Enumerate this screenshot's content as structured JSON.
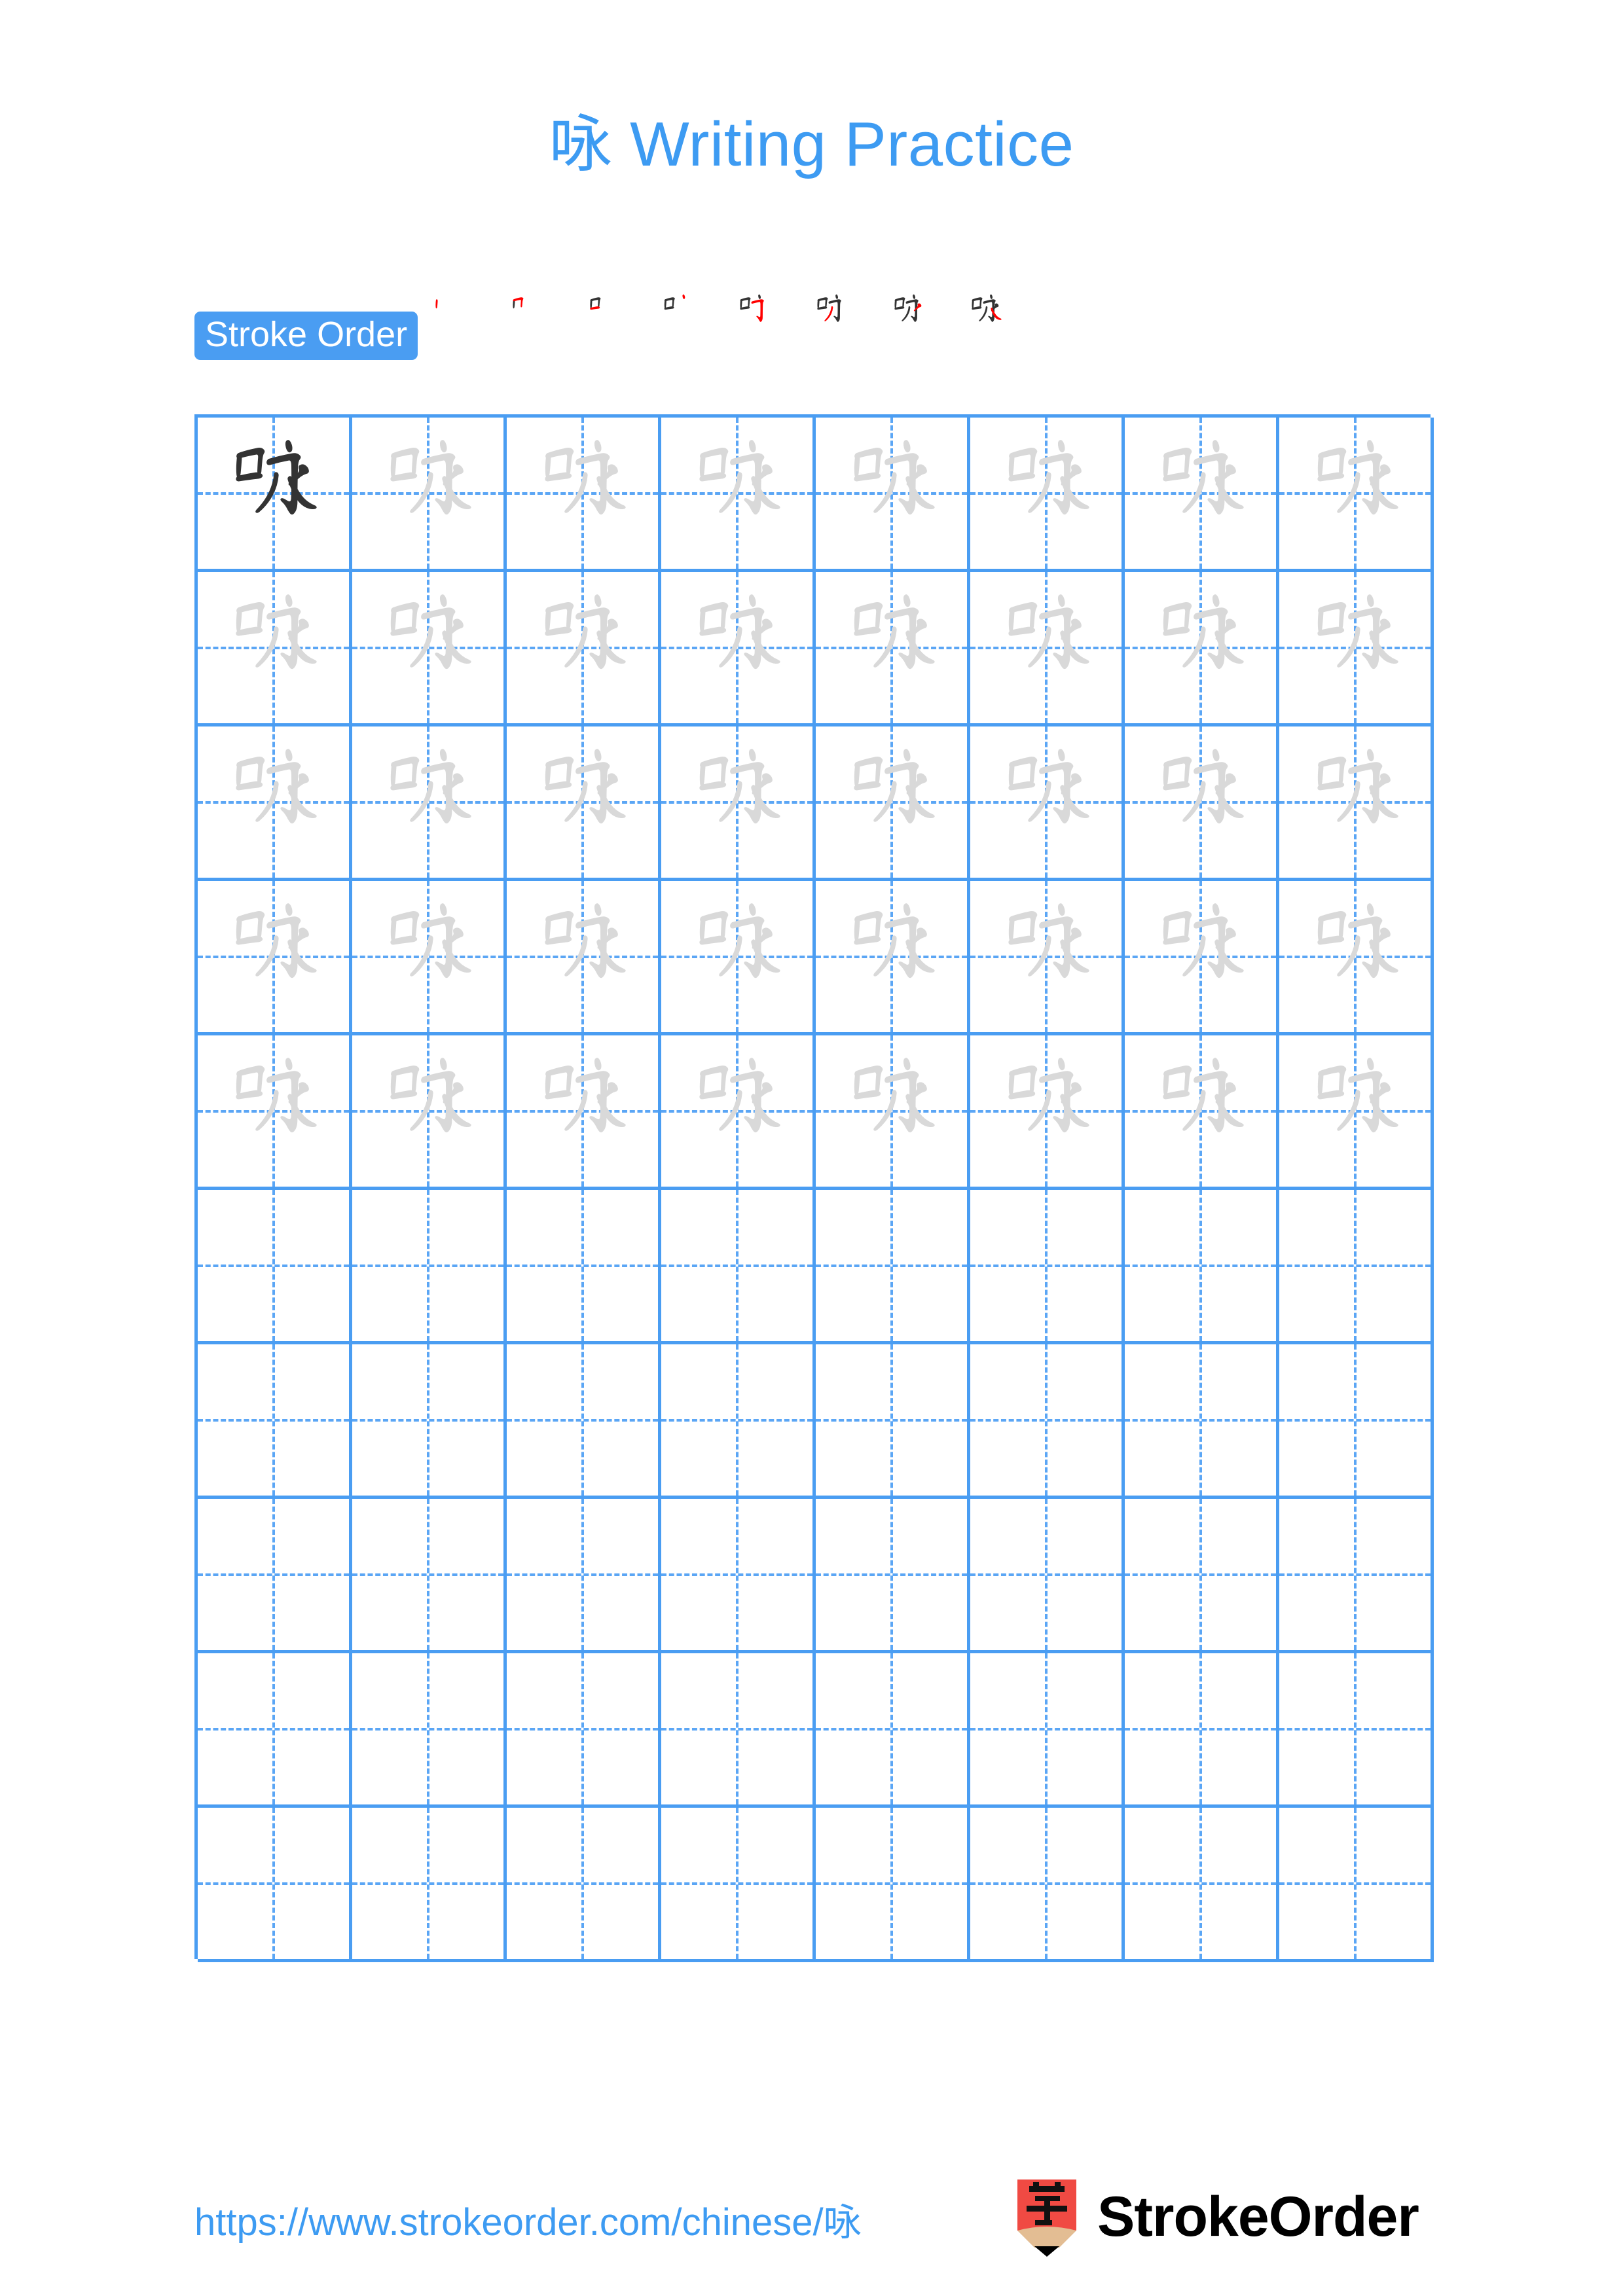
{
  "page": {
    "character": "咏",
    "title": "咏 Writing Practice",
    "background_color": "#ffffff",
    "accent_color": "#3d9bf2",
    "grid_line_color": "#4a9df2",
    "trace_glyph_color": "#d9d9d9",
    "solid_glyph_color": "#333333",
    "stroke_new_color": "#ff0000",
    "stroke_old_color": "#333333"
  },
  "stroke_order": {
    "badge_label": "Stroke Order",
    "stroke_count": 8,
    "steps": [
      {
        "index": 1,
        "name": "shu",
        "cumulative": "丨"
      },
      {
        "index": 2,
        "name": "heng-zhe",
        "cumulative": "冂"
      },
      {
        "index": 3,
        "name": "heng",
        "cumulative": "口"
      },
      {
        "index": 4,
        "name": "dian",
        "cumulative": "口丶"
      },
      {
        "index": 5,
        "name": "heng-zhe-gou",
        "cumulative": "叮"
      },
      {
        "index": 6,
        "name": "heng-pie",
        "cumulative": "叧"
      },
      {
        "index": 7,
        "name": "pie",
        "cumulative": "咏"
      },
      {
        "index": 8,
        "name": "na",
        "cumulative": "咏"
      }
    ]
  },
  "practice_grid": {
    "columns": 8,
    "rows": 10,
    "filled_rows": 5,
    "empty_rows": 5,
    "first_cell_style": "solid",
    "trace_cell_style": "outline-gray",
    "cell_size_px": 236,
    "rows_data": [
      [
        "solid",
        "trace",
        "trace",
        "trace",
        "trace",
        "trace",
        "trace",
        "trace"
      ],
      [
        "trace",
        "trace",
        "trace",
        "trace",
        "trace",
        "trace",
        "trace",
        "trace"
      ],
      [
        "trace",
        "trace",
        "trace",
        "trace",
        "trace",
        "trace",
        "trace",
        "trace"
      ],
      [
        "trace",
        "trace",
        "trace",
        "trace",
        "trace",
        "trace",
        "trace",
        "trace"
      ],
      [
        "trace",
        "trace",
        "trace",
        "trace",
        "trace",
        "trace",
        "trace",
        "trace"
      ],
      [
        "empty",
        "empty",
        "empty",
        "empty",
        "empty",
        "empty",
        "empty",
        "empty"
      ],
      [
        "empty",
        "empty",
        "empty",
        "empty",
        "empty",
        "empty",
        "empty",
        "empty"
      ],
      [
        "empty",
        "empty",
        "empty",
        "empty",
        "empty",
        "empty",
        "empty",
        "empty"
      ],
      [
        "empty",
        "empty",
        "empty",
        "empty",
        "empty",
        "empty",
        "empty",
        "empty"
      ],
      [
        "empty",
        "empty",
        "empty",
        "empty",
        "empty",
        "empty",
        "empty",
        "empty"
      ]
    ]
  },
  "footer": {
    "url": "https://www.strokeorder.com/chinese/咏",
    "brand_name": "StrokeOrder",
    "logo_character": "字",
    "logo_body_color": "#f04a43",
    "logo_wood_color": "#e3bd93",
    "logo_tip_color": "#000000"
  }
}
